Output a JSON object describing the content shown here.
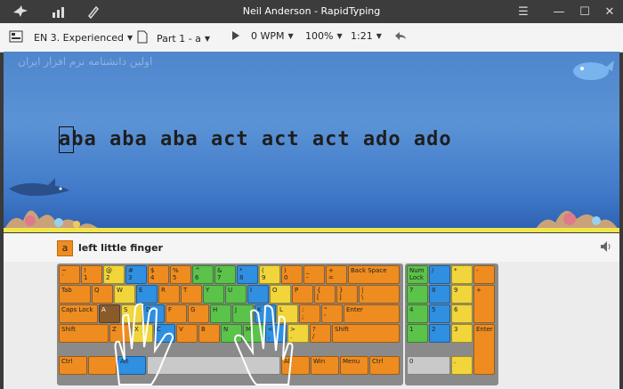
{
  "window": {
    "title": "Neil Anderson - RapidTyping"
  },
  "titlebar_icons": [
    "shark-logo-icon",
    "stats-icon",
    "brush-icon"
  ],
  "window_buttons": {
    "menu": "☰",
    "minimize": "—",
    "maximize": "☐",
    "close": "✕"
  },
  "toolbar": {
    "course": "EN 3. Experienced",
    "part": "Part 1 - a",
    "speed": "0 WPM",
    "zoom": "100%",
    "time": "1:21"
  },
  "lesson": {
    "watermark": "اولین دانشنامه نرم افزار ایران",
    "text": "aba aba aba act act act ado ado"
  },
  "hint": {
    "key": "a",
    "finger": "left little finger"
  },
  "keyboard": {
    "row1": [
      "~\n`",
      "!\n1",
      "@\n2",
      "#\n3",
      "$\n4",
      "%\n5",
      "^\n6",
      "&\n7",
      "*\n8",
      "(\n9",
      ")\n0",
      "_\n-",
      "+\n=",
      "Back Space"
    ],
    "row2": [
      "Tab",
      "Q",
      "W",
      "E",
      "R",
      "T",
      "Y",
      "U",
      "I",
      "O",
      "P",
      "{\n[",
      "}\n]",
      "|\n\\"
    ],
    "row3": [
      "Caps Lock",
      "A",
      "S",
      "D",
      "F",
      "G",
      "H",
      "J",
      "K",
      "L",
      ":\n;",
      "\"\n'",
      "Enter"
    ],
    "row4": [
      "Shift",
      "Z",
      "X",
      "C",
      "V",
      "B",
      "N",
      "M",
      "<\n,",
      ">\n.",
      "?\n/",
      "Shift"
    ],
    "row5": [
      "Ctrl",
      "",
      "Alt",
      "",
      "Alt",
      "Win",
      "Menu",
      "Ctrl"
    ],
    "numpad": [
      "Num\nLock",
      "/",
      "*",
      "-",
      "7",
      "8",
      "9",
      "+",
      "4",
      "5",
      "6",
      "1",
      "2",
      "3",
      "Enter",
      "0",
      "."
    ]
  },
  "colors": {
    "orange": "#ef8c1f",
    "yellow": "#f1d53a",
    "green": "#5bc24a",
    "blue": "#2f8fe0"
  }
}
